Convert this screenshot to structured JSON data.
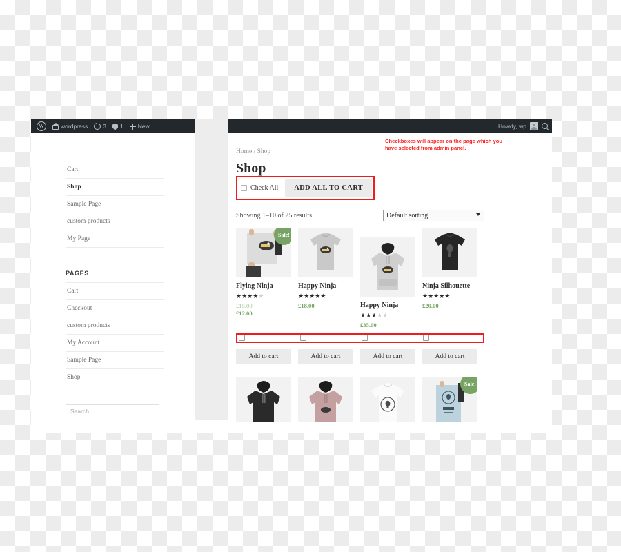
{
  "adminbar": {
    "logo_icon": "wordpress-logo-icon",
    "site_icon": "home-icon",
    "site_name": "wordpress",
    "updates_icon": "updates-circle-icon",
    "updates_count": "3",
    "comments_icon": "comment-bubble-icon",
    "comments_count": "1",
    "new_icon": "plus-icon",
    "new_label": "New",
    "howdy": "Howdy, wp",
    "avatar_icon": "avatar-icon",
    "search_icon": "search-icon"
  },
  "sidebar": {
    "nav_items": [
      {
        "label": "Cart",
        "active": false
      },
      {
        "label": "Shop",
        "active": true
      },
      {
        "label": "Sample Page",
        "active": false
      },
      {
        "label": "custom products",
        "active": false
      },
      {
        "label": "My Page",
        "active": false
      }
    ],
    "pages_widget_title": "PAGES",
    "pages_items": [
      {
        "label": "Cart"
      },
      {
        "label": "Checkout"
      },
      {
        "label": "custom products"
      },
      {
        "label": "My Account"
      },
      {
        "label": "Sample Page"
      },
      {
        "label": "Shop"
      }
    ],
    "search_placeholder": "Search …"
  },
  "main": {
    "breadcrumb": "Home / Shop",
    "page_title": "Shop",
    "check_all_label": "Check All",
    "add_all_to_cart_label": "ADD ALL TO CART",
    "annotation": "Checkboxes will appear on the page which you have selected from admin panel.",
    "result_count": "Showing 1–10 of 25 results",
    "sorting_selected": "Default sorting",
    "add_to_cart_label": "Add to cart",
    "sale_badge": "Sale!",
    "accent_green": "#77a464",
    "annotation_red": "#ff2020",
    "highlight_red": "#ee1c1c"
  },
  "products_row1": [
    {
      "name": "Flying Ninja",
      "rating": 4,
      "price": "£12.00",
      "regular_price": "£15.00",
      "on_sale": true,
      "thumb": "poster-held-by-hands",
      "checked": false
    },
    {
      "name": "Happy Ninja",
      "rating": 5,
      "price": "£18.00",
      "regular_price": "",
      "on_sale": false,
      "thumb": "grey-tshirt",
      "checked": false
    },
    {
      "name": "Happy Ninja",
      "rating": 3,
      "price": "£35.00",
      "regular_price": "",
      "on_sale": false,
      "thumb": "grey-hoodie",
      "checked": false
    },
    {
      "name": "Ninja Silhouette",
      "rating": 5,
      "price": "£20.00",
      "regular_price": "",
      "on_sale": false,
      "thumb": "black-tshirt",
      "checked": false
    }
  ],
  "products_row2": [
    {
      "thumb": "black-hoodie",
      "on_sale": false
    },
    {
      "thumb": "pink-hoodie",
      "on_sale": false
    },
    {
      "thumb": "white-tshirt",
      "on_sale": false
    },
    {
      "thumb": "blue-poster",
      "on_sale": true
    }
  ]
}
